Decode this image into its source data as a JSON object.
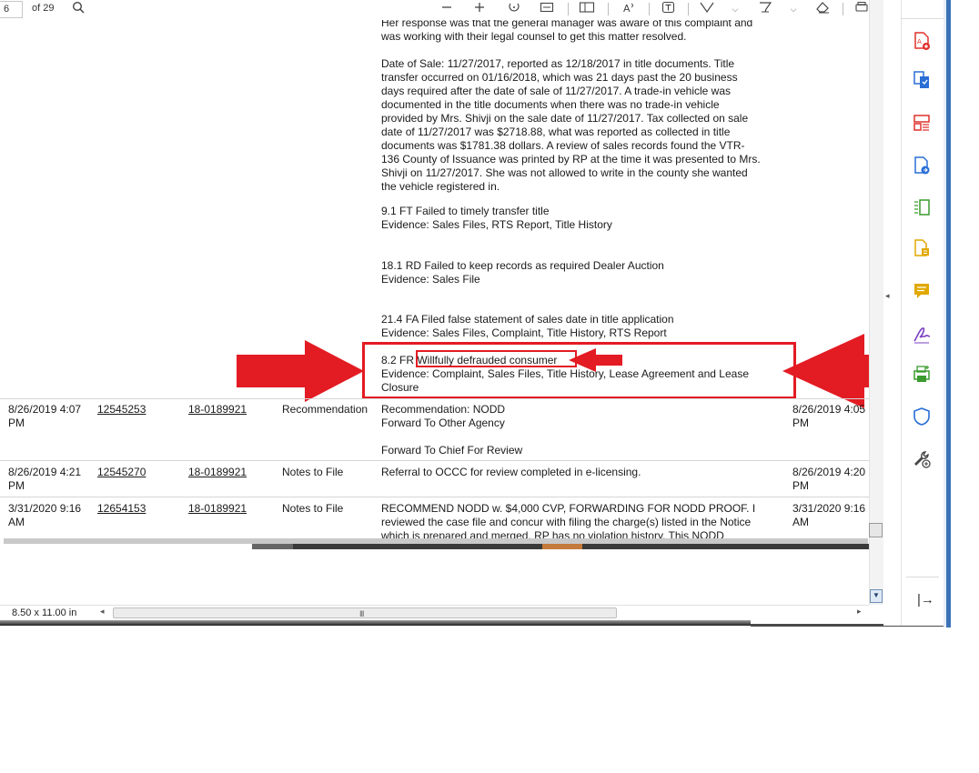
{
  "toolbar": {
    "page_number": "6",
    "page_total": "of 29",
    "icons": [
      "search-icon",
      "zoom-out-icon",
      "zoom-in-icon",
      "rotate-icon",
      "fit-width-icon",
      "page-view-icon",
      "read-aloud-icon",
      "text-box-icon",
      "highlight-icon",
      "draw-icon",
      "erase-icon",
      "print-icon"
    ]
  },
  "notes": {
    "top_partial_line": "Her response was that the general manager was aware of this complaint and",
    "top_line2": "was working with their legal counsel to get this matter resolved.",
    "para1": [
      "Date of Sale: 11/27/2017, reported as 12/18/2017 in title documents. Title",
      "transfer occurred on 01/16/2018, which was 21 days past the 20 business",
      "days required after the date of sale of 11/27/2017. A trade-in vehicle was",
      "documented in the title documents when there was no trade-in vehicle",
      "provided by Mrs. Shivji on the sale date of 11/27/2017. Tax collected on sale",
      "date of 11/27/2017 was $2718.88, what was reported as collected in title",
      "documents was $1781.38 dollars. A review of sales records found the VTR-",
      "136 County of Issuance was printed by RP at the time it was presented to Mrs.",
      "Shivji on 11/27/2017. She was not allowed to write in the county she wanted",
      "the vehicle registered in."
    ],
    "v91_title": "9.1 FT Failed to timely transfer title",
    "v91_evidence": "Evidence: Sales Files, RTS Report, Title History",
    "v181_title": "18.1 RD Failed to keep records as required Dealer Auction",
    "v181_evidence": "Evidence: Sales File",
    "v214_title": "21.4 FA Filed false statement of sales date in title application",
    "v214_evidence": "Evidence: Sales Files, Complaint, Title History, RTS Report",
    "v82_code": "8.2 FR",
    "v82_highlight": "Willfully defrauded consumer",
    "v82_evidence_1": "Evidence: Complaint, Sales Files, Title History, Lease Agreement and Lease",
    "v82_evidence_2": "Closure"
  },
  "rows": [
    {
      "date_1": "8/26/2019 4:07",
      "date_2": "PM",
      "id": "12545253",
      "case": "18-0189921",
      "type": "Recommendation",
      "notes_1": "Recommendation: NODD",
      "notes_2": "Forward To Other Agency",
      "notes_3": "Forward To Chief For Review",
      "updated_1": "8/26/2019 4:05",
      "updated_2": "PM"
    },
    {
      "date_1": "8/26/2019 4:21",
      "date_2": "PM",
      "id": "12545270",
      "case": "18-0189921",
      "type": "Notes to File",
      "notes_1": "Referral to OCCC for review completed in e-licensing.",
      "updated_1": "8/26/2019 4:20",
      "updated_2": "PM"
    },
    {
      "date_1": "3/31/2020 9:16",
      "date_2": "AM",
      "id": "12654153",
      "case": "18-0189921",
      "type": "Notes to File",
      "notes_1": "RECOMMEND NODD w. $4,000 CVP, FORWARDING FOR NODD PROOF. I",
      "notes_2": "reviewed the case file and concur with filing the charge(s) listed in the Notice",
      "notes_3": "which is prepared and merged. RP has no violation history. This NODD",
      "updated_1": "3/31/2020 9:16",
      "updated_2": "AM"
    }
  ],
  "statusbar": {
    "page_size": "8.50 x 11.00 in",
    "scroll_left": "◂",
    "scroll_right": "▸",
    "grip": "III"
  },
  "right_panel": {
    "collapse_arrow": "◂",
    "exit_icon": "|→",
    "tools": [
      "create-pdf-icon",
      "export-pdf-icon",
      "organize-pages-icon",
      "edit-pdf-icon",
      "compress-pdf-icon",
      "export-pages-icon",
      "comment-icon",
      "fill-sign-icon",
      "print-production-icon",
      "protect-icon",
      "more-tools-icon"
    ]
  },
  "annotation_color": "#e31b23"
}
